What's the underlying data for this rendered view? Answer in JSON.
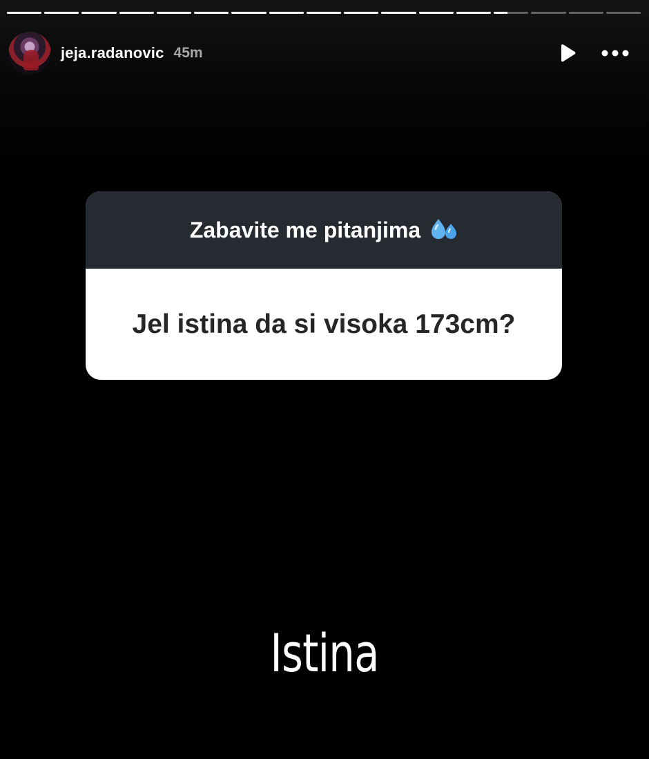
{
  "progress": {
    "segment_count": 17,
    "completed_segments": 13,
    "current_segment_fill": 0.4
  },
  "header": {
    "username": "jeja.radanovic",
    "timestamp": "45m",
    "play_icon": "play-icon",
    "more_icon": "more-horizontal-icon"
  },
  "sticker": {
    "title": "Zabavite me pitanjima",
    "title_emoji": "sweat-droplets-icon",
    "question": "Jel istina da si visoka 173cm?",
    "header_color": "#262a31",
    "body_color": "#ffffff"
  },
  "answer": {
    "text": "Istina"
  }
}
